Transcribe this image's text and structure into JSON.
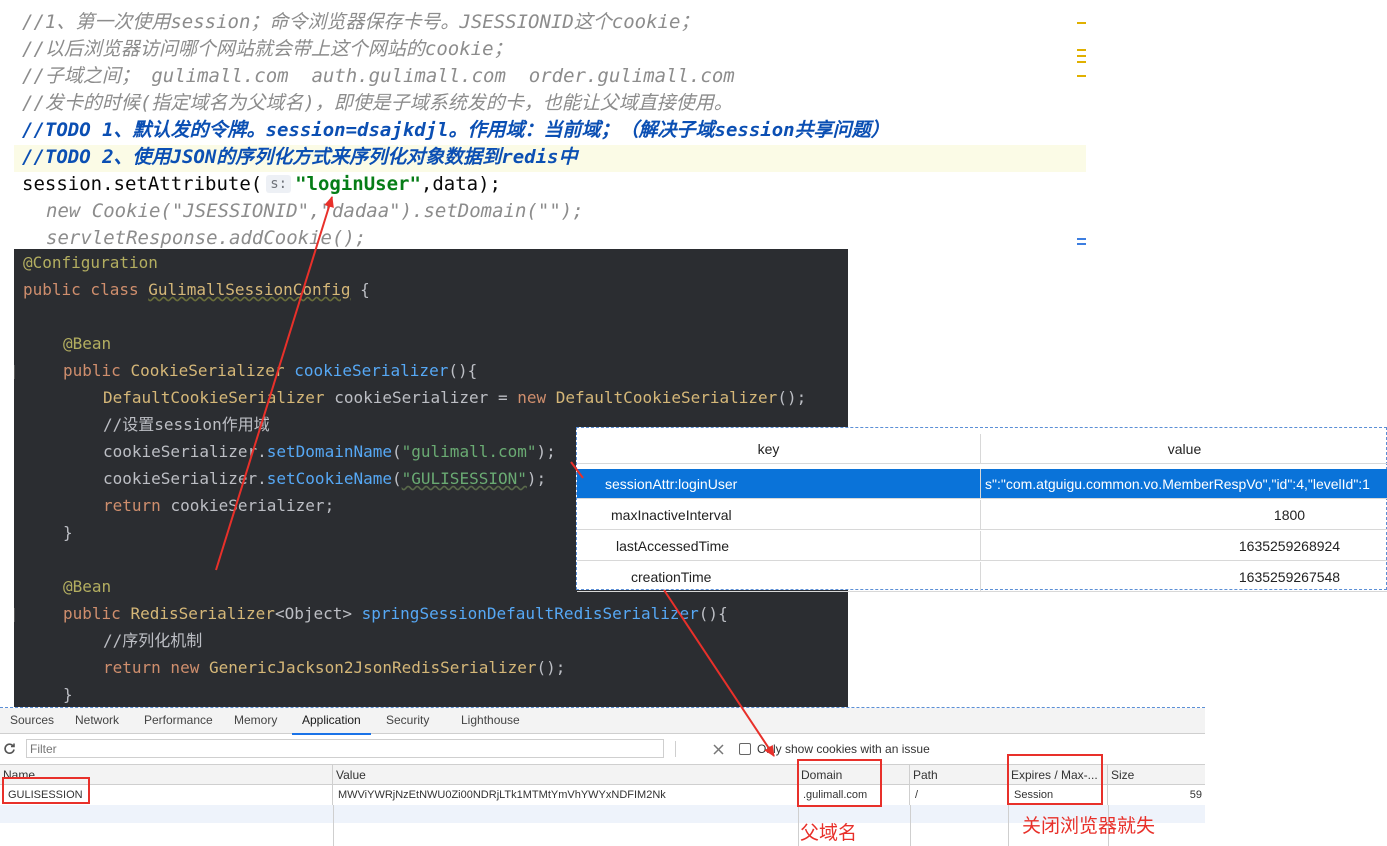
{
  "top_editor": {
    "comment1": "//1、第一次使用session；命令浏览器保存卡号。JSESSIONID这个cookie；",
    "comment2": "//以后浏览器访问哪个网站就会带上这个网站的cookie；",
    "comment3": "//子域之间； gulimall.com  auth.gulimall.com  order.gulimall.com",
    "comment4": "//发卡的时候(指定域名为父域名)，即使是子域系统发的卡，也能让父域直接使用。",
    "todo1": "//TODO 1、默认发的令牌。session=dsajkdjl。作用域：当前域；（解决子域session共享问题）",
    "todo2": "//TODO 2、使用JSON的序列化方式来序列化对象数据到redis中",
    "code_prefix": "session.setAttribute(",
    "param_hint": "s:",
    "code_string": "\"loginUser\"",
    "code_suffix": ",data);",
    "cookie_line": "new Cookie(\"JSESSIONID\",\"dadaa\").setDomain(\"\");",
    "response_line": "servletResponse.addCookie();"
  },
  "dark_editor": {
    "annotation_config": "@Configuration",
    "class_keywords": "public class ",
    "class_name": "GulimallSessionConfig",
    "brace_open": " {",
    "bean1": "@Bean",
    "m1_kw": "public ",
    "m1_type": "CookieSerializer ",
    "m1_name": "cookieSerializer",
    "m1_tail": "(){",
    "l1_type": "DefaultCookieSerializer ",
    "l1_var": "cookieSerializer = ",
    "l1_new": "new ",
    "l1_ctor": "DefaultCookieSerializer",
    "l1_tail": "();",
    "c1": "//设置session作用域",
    "l2_obj": "cookieSerializer.",
    "l2_fn": "setDomainName",
    "l2_open": "(",
    "l2_str": "\"gulimall.com\"",
    "l2_close": ");",
    "l3_obj": "cookieSerializer.",
    "l3_fn": "setCookieName",
    "l3_open": "(",
    "l3_str": "\"GULISESSION\"",
    "l3_close": ");",
    "l4_kw": "return ",
    "l4_var": "cookieSerializer;",
    "close1": "}",
    "bean2": "@Bean",
    "m2_kw": "public ",
    "m2_type": "RedisSerializer",
    "m2_generic": "<Object> ",
    "m2_name": "springSessionDefaultRedisSerializer",
    "m2_tail": "(){",
    "c2": "//序列化机制",
    "l5_kw": "return new ",
    "l5_ctor": "GenericJackson2JsonRedisSerializer",
    "l5_tail": "();",
    "close2": "}"
  },
  "redis_table": {
    "header_key": "key",
    "header_value": "value",
    "rows": [
      {
        "key": "sessionAttr:loginUser",
        "value": "s\":\"com.atguigu.common.vo.MemberRespVo\",\"id\":4,\"levelId\":1"
      },
      {
        "key": "maxInactiveInterval",
        "value": "1800"
      },
      {
        "key": "lastAccessedTime",
        "value": "1635259268924"
      },
      {
        "key": "creationTime",
        "value": "1635259267548"
      }
    ]
  },
  "devtools": {
    "tabs": [
      "Sources",
      "Network",
      "Performance",
      "Memory",
      "Application",
      "Security",
      "Lighthouse"
    ],
    "active_tab": "Application",
    "filter_placeholder": "Filter",
    "only_issue_label": "Only show cookies with an issue",
    "columns": [
      "Name",
      "Value",
      "Domain",
      "Path",
      "Expires / Max-...",
      "Size"
    ],
    "cookie": {
      "name": "GULISESSION",
      "value": "MWViYWRjNzEtNWU0Zi00NDRjLTk1MTMtYmVhYWYxNDFIM2Nk",
      "domain": ".gulimall.com",
      "path": "/",
      "expires": "Session",
      "size": "59"
    }
  },
  "annotations": {
    "parent_domain": "父域名",
    "close_browser": "关闭浏览器就失"
  },
  "colors": {
    "dark_bg": "#2b2d31",
    "selection": "#0a73d9",
    "red": "#e8302a",
    "todo_blue": "#0b4fb3"
  }
}
